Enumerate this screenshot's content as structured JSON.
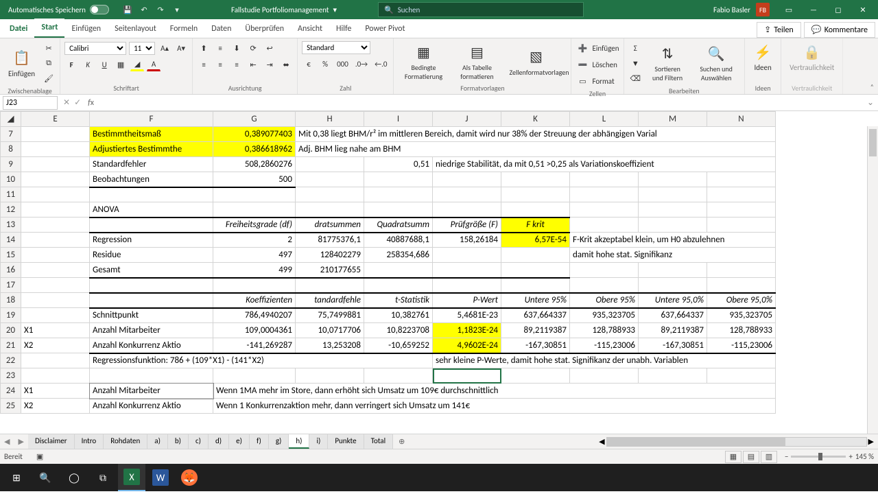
{
  "titlebar": {
    "autosave": "Automatisches Speichern",
    "doctitle": "Fallstudie Portfoliomanagement",
    "search_placeholder": "Suchen",
    "user_name": "Fabio Basler",
    "user_initials": "FB"
  },
  "tabs": {
    "file": "Datei",
    "home": "Start",
    "insert": "Einfügen",
    "layout": "Seitenlayout",
    "formulas": "Formeln",
    "data": "Daten",
    "review": "Überprüfen",
    "view": "Ansicht",
    "help": "Hilfe",
    "powerpivot": "Power Pivot",
    "share": "Teilen",
    "comments": "Kommentare"
  },
  "ribbon": {
    "clipboard": {
      "paste": "Einfügen",
      "label": "Zwischenablage"
    },
    "font": {
      "name": "Calibri",
      "size": "11",
      "label": "Schriftart"
    },
    "align": {
      "label": "Ausrichtung"
    },
    "number": {
      "format": "Standard",
      "label": "Zahl"
    },
    "styles": {
      "cond": "Bedingte Formatierung",
      "table": "Als Tabelle formatieren",
      "cell": "Zellenformatvorlagen",
      "label": "Formatvorlagen"
    },
    "cells": {
      "insert": "Einfügen",
      "delete": "Löschen",
      "format": "Format",
      "label": "Zellen"
    },
    "editing": {
      "sort": "Sortieren und Filtern",
      "find": "Suchen und Auswählen",
      "label": "Bearbeiten"
    },
    "ideas": {
      "btn": "Ideen",
      "label": "Ideen"
    },
    "sens": {
      "btn": "Vertraulichkeit",
      "label": "Vertraulichkeit"
    }
  },
  "fbar": {
    "cellref": "J23",
    "formula": ""
  },
  "cols": [
    "",
    "E",
    "F",
    "G",
    "H",
    "I",
    "J",
    "K",
    "L",
    "M",
    "N"
  ],
  "rows": {
    "7": {
      "F": "Bestimmtheitsmaß",
      "G": "0,389077403",
      "H": "Mit 0,38 liegt BHM/r² im mittleren Bereich, damit wird nur 38% der Streuung der abhängigen Varial"
    },
    "8": {
      "F": "Adjustiertes Bestimmthe",
      "G": "0,386618962",
      "H": "Adj. BHM lieg nahe am BHM"
    },
    "9": {
      "F": "Standardfehler",
      "G": "508,2860276",
      "I": "0,51",
      "J": "niedrige Stabilität, da mit 0,51 >0,25 als Variationskoeffizient"
    },
    "10": {
      "F": "Beobachtungen",
      "G": "500"
    },
    "12": {
      "F": "ANOVA"
    },
    "13": {
      "G": "Freiheitsgrade (df)",
      "H": "dratsummen",
      "I": "Quadratsumm",
      "J": "Prüfgröße (F)",
      "K": "F krit"
    },
    "14": {
      "F": "Regression",
      "G": "2",
      "H": "81775376,1",
      "I": "40887688,1",
      "J": "158,26184",
      "K": "6,57E-54",
      "L": "F-Krit akzeptabel klein, um H0 abzulehnen"
    },
    "15": {
      "F": "Residue",
      "G": "497",
      "H": "128402279",
      "I": "258354,686",
      "L": "damit hohe stat. Signifikanz"
    },
    "16": {
      "F": "Gesamt",
      "G": "499",
      "H": "210177655"
    },
    "18": {
      "G": "Koeffizienten",
      "H": "tandardfehle",
      "I": "t-Statistik",
      "J": "P-Wert",
      "K": "Untere 95%",
      "L": "Obere 95%",
      "M": "Untere 95,0%",
      "N": "Obere 95,0%"
    },
    "19": {
      "F": "Schnittpunkt",
      "G": "786,4940207",
      "H": "75,7499881",
      "I": "10,382761",
      "J": "5,4681E-23",
      "K": "637,664337",
      "L": "935,323705",
      "M": "637,664337",
      "N": "935,323705"
    },
    "20": {
      "E": "X1",
      "F": "Anzahl Mitarbeiter",
      "G": "109,0004361",
      "H": "10,0717706",
      "I": "10,8223708",
      "J": "1,1823E-24",
      "K": "89,2119387",
      "L": "128,788933",
      "M": "89,2119387",
      "N": "128,788933"
    },
    "21": {
      "E": "X2",
      "F": "Anzahl Konkurrenz Aktio",
      "G": "-141,269287",
      "H": "13,253208",
      "I": "-10,659252",
      "J": "4,9602E-24",
      "K": "-167,30851",
      "L": "-115,23006",
      "M": "-167,30851",
      "N": "-115,23006"
    },
    "22": {
      "F": "Regressionsfunktion: 786 + (109*X1) - (141*X2)",
      "J": "sehr kleine P-Werte, damit hohe stat. Signifikanz der unabh. Variablen"
    },
    "24": {
      "E": "X1",
      "F": "Anzahl Mitarbeiter",
      "G": "Wenn 1MA mehr im Store, dann erhöht sich Umsatz um 109€ durchschnittlich"
    },
    "25": {
      "E": "X2",
      "F": "Anzahl Konkurrenz Aktio",
      "G": "Wenn 1 Konkurrenzaktion mehr, dann verringert sich Umsatz um 141€"
    }
  },
  "sheets": [
    "Disclaimer",
    "Intro",
    "Rohdaten",
    "a)",
    "b)",
    "c)",
    "d)",
    "e)",
    "f)",
    "g)",
    "h)",
    "i)",
    "Punkte",
    "Total"
  ],
  "active_sheet": "h)",
  "status": {
    "ready": "Bereit",
    "zoom": "145 %"
  },
  "chart_data": {
    "type": "table",
    "title": "Regression Output",
    "stats": {
      "Bestimmtheitsmaß": 0.389077403,
      "Adjustiertes Bestimmtheitsmaß": 0.386618962,
      "Standardfehler": 508.2860276,
      "Beobachtungen": 500
    },
    "anova": [
      {
        "name": "Regression",
        "df": 2,
        "ss": 81775376.1,
        "ms": 40887688.1,
        "F": 158.26184,
        "Fkrit": 6.57e-54
      },
      {
        "name": "Residue",
        "df": 497,
        "ss": 128402279,
        "ms": 258354.686
      },
      {
        "name": "Gesamt",
        "df": 499,
        "ss": 210177655
      }
    ],
    "coefficients": [
      {
        "name": "Schnittpunkt",
        "coef": 786.4940207,
        "se": 75.7499881,
        "t": 10.382761,
        "p": 5.4681e-23,
        "lo95": 637.664337,
        "hi95": 935.323705
      },
      {
        "name": "Anzahl Mitarbeiter",
        "coef": 109.0004361,
        "se": 10.0717706,
        "t": 10.8223708,
        "p": 1.1823e-24,
        "lo95": 89.2119387,
        "hi95": 128.788933
      },
      {
        "name": "Anzahl Konkurrenz Aktio",
        "coef": -141.269287,
        "se": 13.253208,
        "t": -10.659252,
        "p": 4.9602e-24,
        "lo95": -167.30851,
        "hi95": -115.23006
      }
    ]
  }
}
